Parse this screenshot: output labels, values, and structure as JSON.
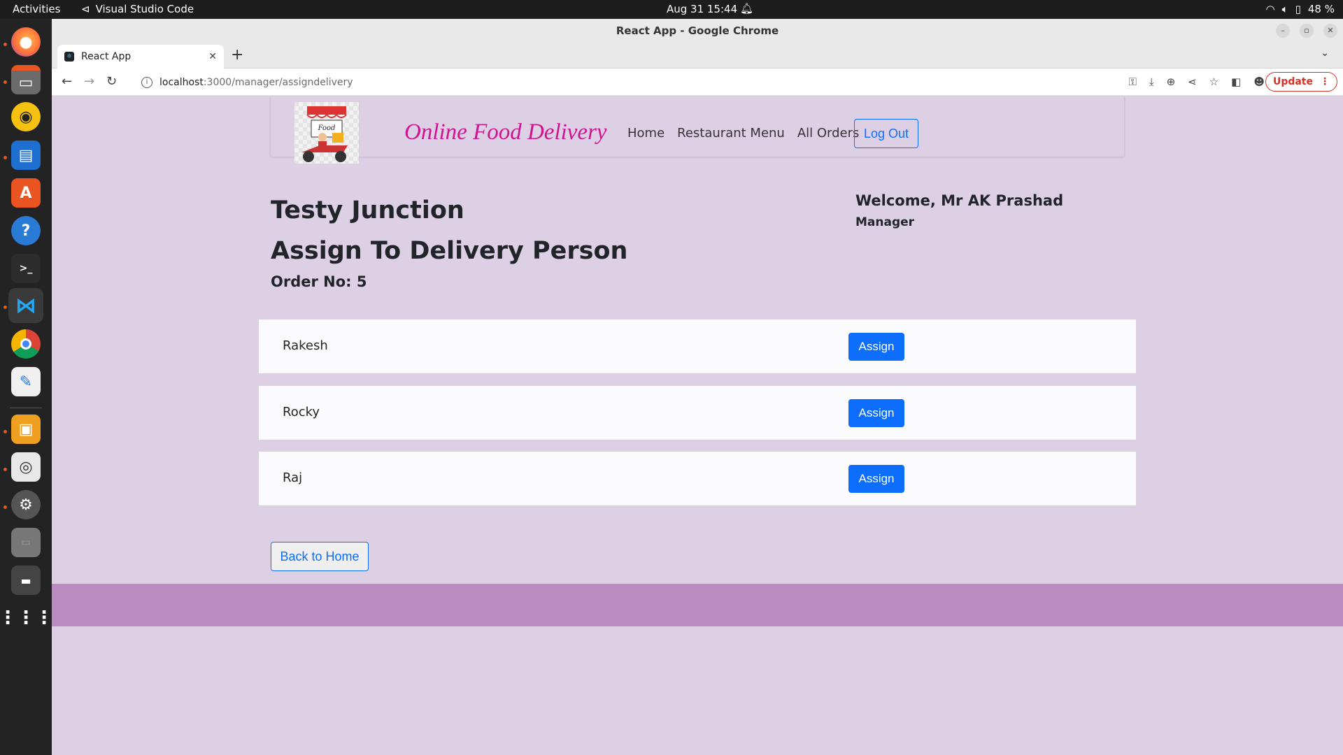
{
  "system": {
    "activities": "Activities",
    "app_name": "Visual Studio Code",
    "clock": "Aug 31  15:44",
    "battery": "48 %"
  },
  "dock": {
    "items": [
      "firefox-icon",
      "files-icon",
      "rhythmbox-icon",
      "writer-icon",
      "app-center-icon",
      "help-icon",
      "terminal-icon",
      "vscode-icon",
      "chrome-icon",
      "text-editor-icon",
      "impress-icon",
      "document-viewer-icon",
      "settings-icon",
      "ssd-icon",
      "trash-icon",
      "app-grid-icon"
    ]
  },
  "browser": {
    "window_title": "React App - Google Chrome",
    "tab_title": "React App",
    "url_host": "localhost",
    "url_path": ":3000/manager/assigndelivery",
    "update_label": "Update"
  },
  "navbar": {
    "brand": "Online Food Delivery",
    "links": [
      "Home",
      "Restaurant Menu",
      "All Orders"
    ],
    "logout_label": "Log Out"
  },
  "main": {
    "restaurant_name": "Testy Junction",
    "heading": "Assign To Delivery Person",
    "order_label": "Order No: 5",
    "welcome": "Welcome, Mr AK Prashad",
    "role": "Manager",
    "persons": [
      {
        "name": "Rakesh",
        "button": "Assign"
      },
      {
        "name": "Rocky",
        "button": "Assign"
      },
      {
        "name": "Raj",
        "button": "Assign"
      }
    ],
    "back_label": "Back to Home"
  },
  "colors": {
    "page_bg": "#ded0e4",
    "footer_bg": "#b98bc1",
    "brand": "#d0148f",
    "primary": "#0d6efd"
  }
}
